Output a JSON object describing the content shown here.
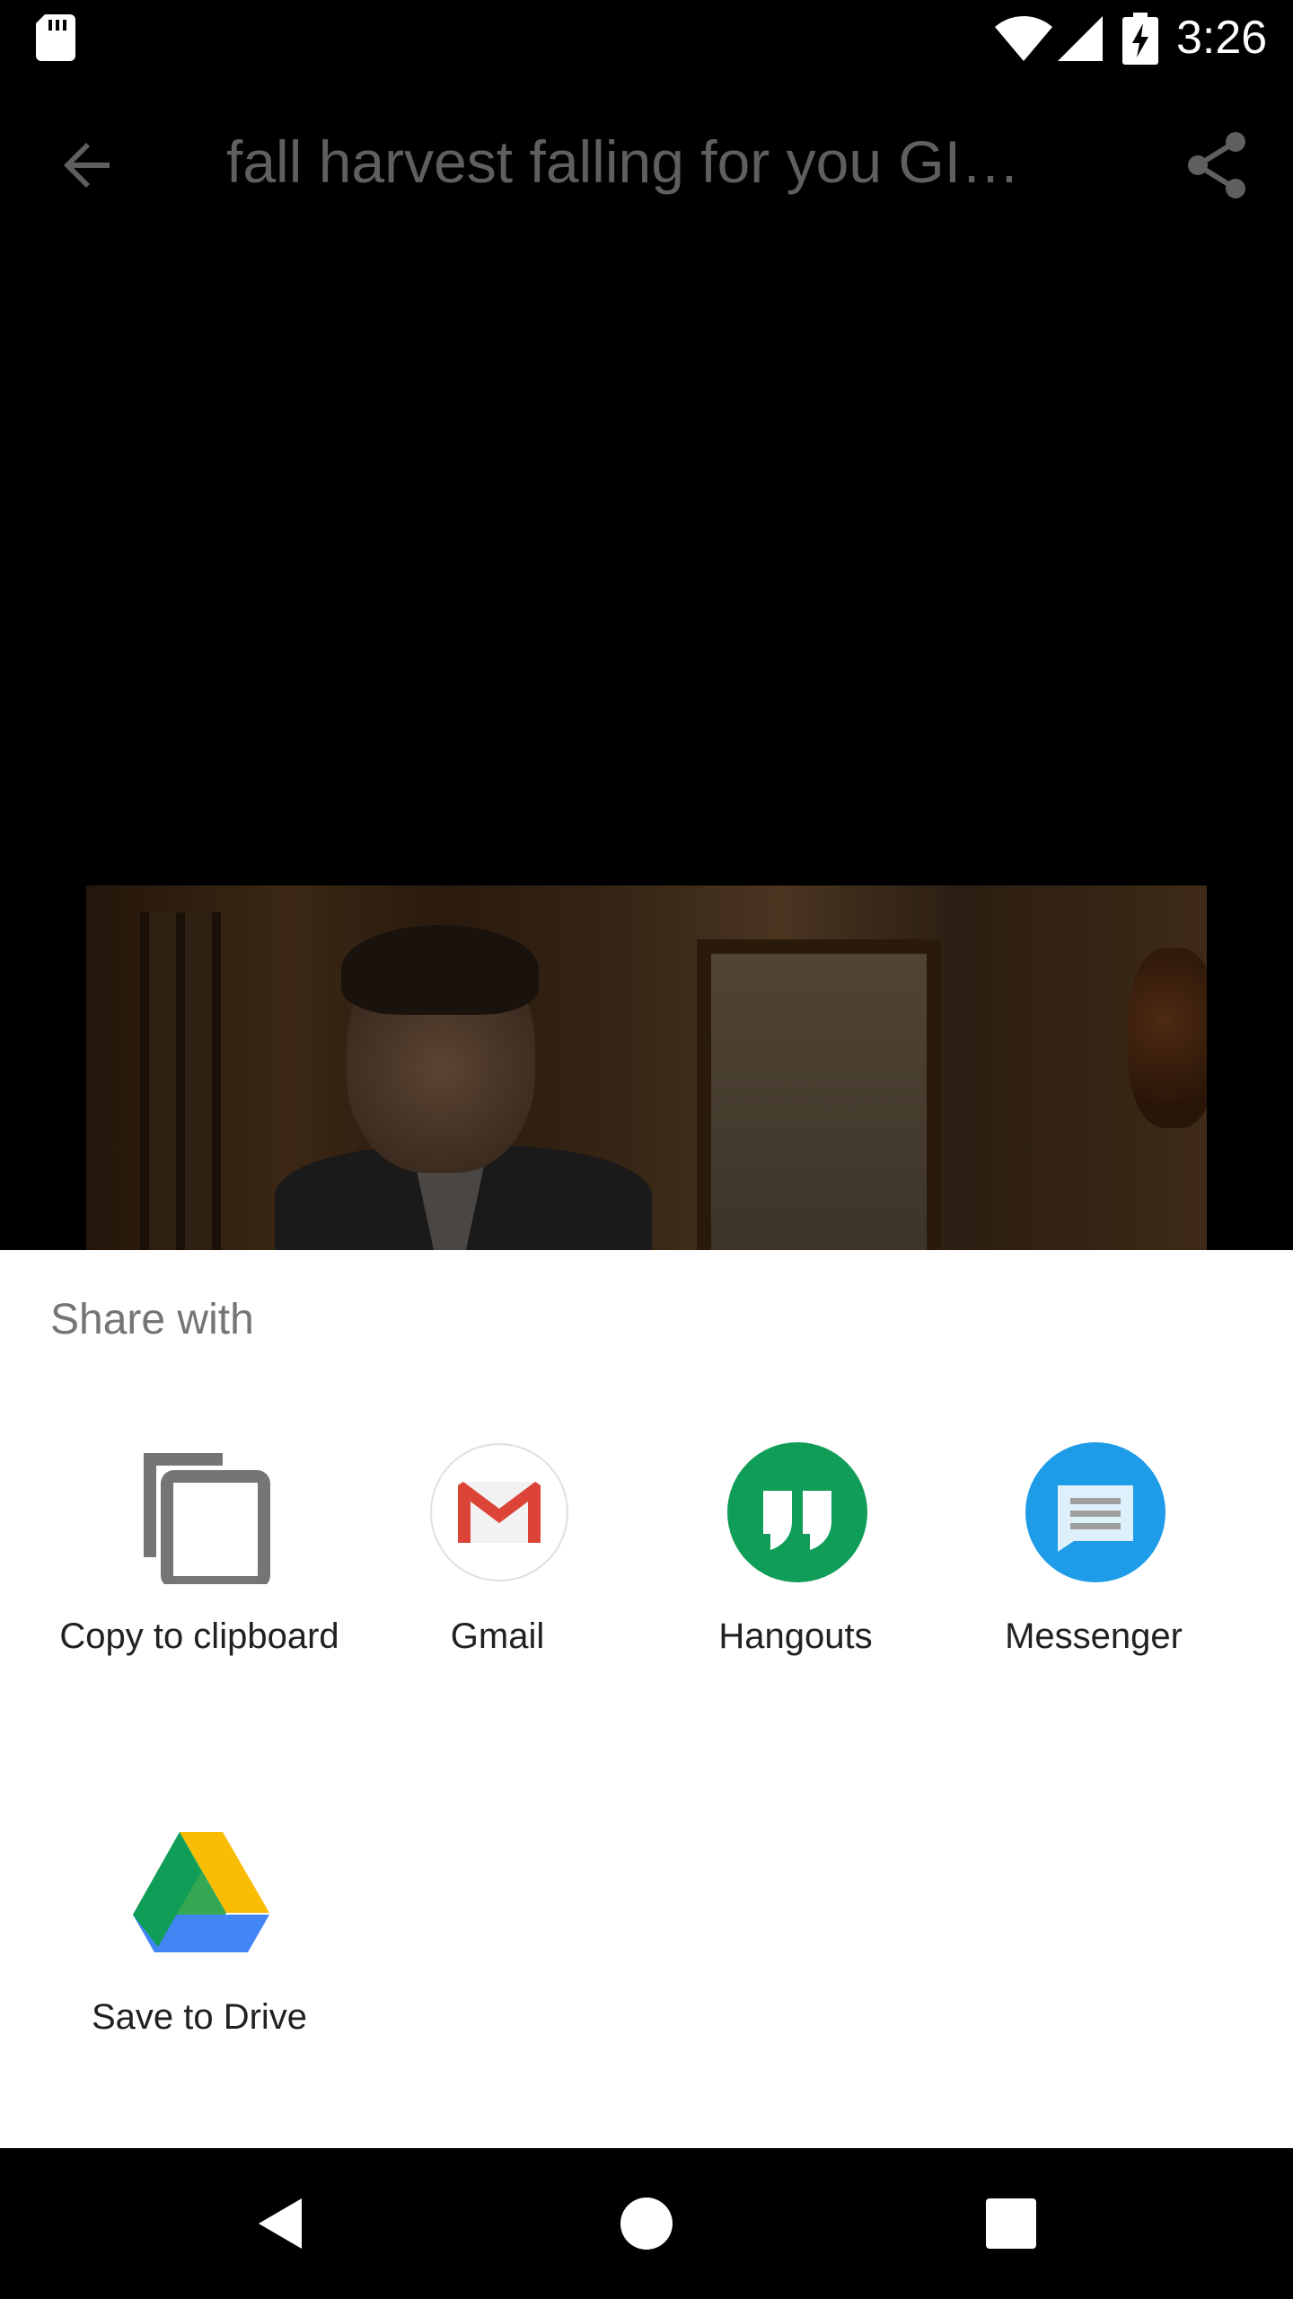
{
  "status_bar": {
    "time": "3:26",
    "icons": [
      "sd-card-icon",
      "wifi-icon",
      "cell-signal-icon",
      "battery-charging-icon"
    ]
  },
  "app_bar": {
    "title": "fall harvest falling for you GI…",
    "back_icon": "arrow-back-icon",
    "share_icon": "share-icon",
    "title_color": "#5f5f5f"
  },
  "share_sheet": {
    "title": "Share with",
    "targets": [
      {
        "label": "Copy to clipboard",
        "icon": "copy-icon"
      },
      {
        "label": "Gmail",
        "icon": "gmail-icon"
      },
      {
        "label": "Hangouts",
        "icon": "hangouts-icon"
      },
      {
        "label": "Messenger",
        "icon": "messenger-icon"
      },
      {
        "label": "Save to Drive",
        "icon": "drive-icon"
      }
    ],
    "colors": {
      "gmail_red": "#db4437",
      "hangouts_green": "#0f9d58",
      "messenger_blue": "#1e9ce8",
      "drive_yellow": "#fbbc04",
      "drive_green": "#34a853",
      "drive_blue": "#4285f4"
    }
  },
  "nav_bar": {
    "icons": [
      "nav-back-icon",
      "nav-home-icon",
      "nav-recents-icon"
    ]
  }
}
